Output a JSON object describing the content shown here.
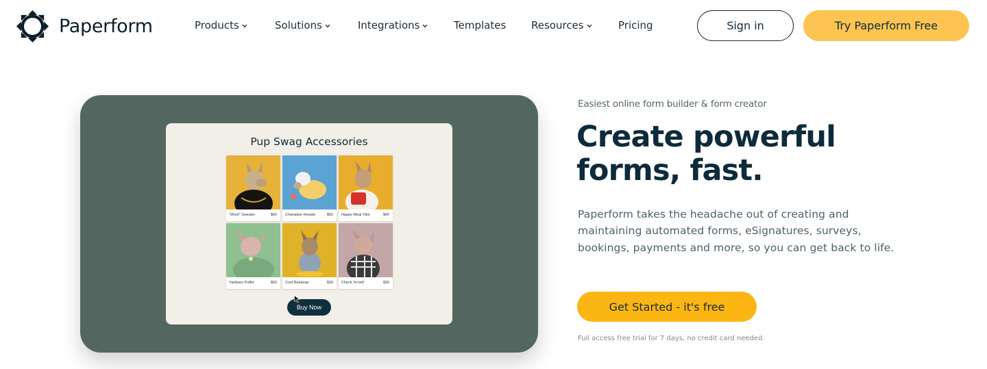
{
  "header": {
    "brand": "Paperform",
    "nav": [
      {
        "label": "Products",
        "has_dropdown": true
      },
      {
        "label": "Solutions",
        "has_dropdown": true
      },
      {
        "label": "Integrations",
        "has_dropdown": true
      },
      {
        "label": "Templates",
        "has_dropdown": false
      },
      {
        "label": "Resources",
        "has_dropdown": true
      },
      {
        "label": "Pricing",
        "has_dropdown": false
      }
    ],
    "signin_label": "Sign in",
    "try_label": "Try Paperform Free"
  },
  "hero": {
    "eyebrow": "Easiest online form builder & form creator",
    "headline": "Create powerful forms, fast.",
    "description": "Paperform takes the headache out of creating and maintaining automated forms, eSignatures, surveys, bookings, payments and more, so you can get back to life.",
    "cta_label": "Get Started - it's free",
    "fineprint": "Full access free trial for 7 days, no credit card needed."
  },
  "preview": {
    "title": "Pup Swag Accessories",
    "products": [
      {
        "name": "\"Woof\" Sweater",
        "price": "$60",
        "bg": "#e6b23a"
      },
      {
        "name": "Champion Hoodie",
        "price": "$50",
        "bg": "#5aa3d2"
      },
      {
        "name": "Happy Meal Vibe",
        "price": "$40",
        "bg": "#e9ad2e"
      },
      {
        "name": "Yankees Puffer",
        "price": "$50",
        "bg": "#8ec18f"
      },
      {
        "name": "Cool Bananas",
        "price": "$30",
        "bg": "#e0b229"
      },
      {
        "name": "Check Yo'self",
        "price": "$30",
        "bg": "#c3a6a6"
      }
    ],
    "buy_label": "Buy Now"
  },
  "colors": {
    "brand_dark": "#0d2b3a",
    "accent_yellow": "#fdc451",
    "cta_yellow": "#fbb614",
    "card_green": "#536760",
    "preview_bg": "#f2efe8"
  },
  "icons": [
    "paperform-logo-icon",
    "chevron-down-icon",
    "cursor-icon"
  ]
}
